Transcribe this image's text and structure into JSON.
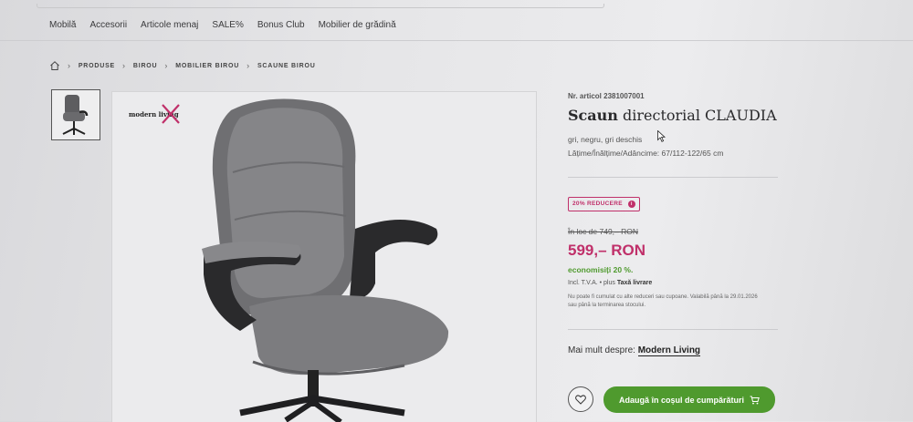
{
  "nav": {
    "items": [
      "Mobilă",
      "Accesorii",
      "Articole menaj",
      "SALE%",
      "Bonus Club",
      "Mobilier de grădină"
    ]
  },
  "breadcrumb": {
    "home_icon": "home-icon",
    "items": [
      "PRODUSE",
      "BIROU",
      "MOBILIER BIROU",
      "SCAUNE BIROU"
    ]
  },
  "gallery": {
    "brand_logo": "modern living"
  },
  "product": {
    "article_number": "Nr. articol 2381007001",
    "title_bold": "Scaun",
    "title_rest": " directorial CLAUDIA",
    "colors": "gri, negru, gri deschis",
    "dimensions": "Lățime/Înălțime/Adâncime: 67/112-122/65 cm",
    "discount_badge": "20% REDUCERE",
    "old_price": "În loc de 749,– RON",
    "price": "599,– RON",
    "savings": "economisiți 20 %.",
    "vat_prefix": "Incl. T.V.A.  •  plus ",
    "vat_link": "Taxă livrare",
    "note": "Nu poate fi cumulat cu alte reduceri sau cupoane. Valabilă până la 29.01.2026 sau până la terminarea stocului.",
    "more_about_label": "Mai mult despre: ",
    "more_about_brand": "Modern Living",
    "add_to_cart": "Adaugă în coșul de cumpărături"
  },
  "colors": {
    "accent": "#c0306a",
    "cart": "#4f9a2e"
  }
}
